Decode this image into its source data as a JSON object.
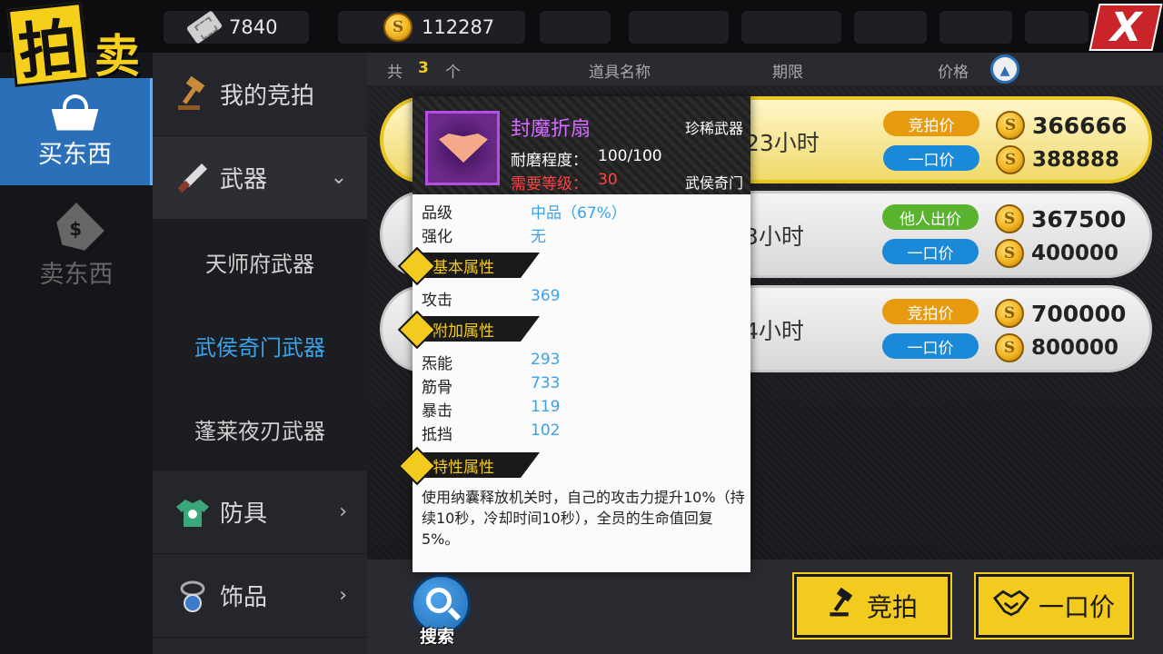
{
  "logo": {
    "char1": "拍",
    "char2": "卖"
  },
  "currency": {
    "tickets": "7840",
    "coins": "112287"
  },
  "close_label": "X",
  "left_tabs": [
    {
      "label": "买东西",
      "icon": "basket-icon",
      "active": true
    },
    {
      "label": "卖东西",
      "icon": "price-tag-icon",
      "active": false
    }
  ],
  "categories": {
    "my_bids": "我的竞拍",
    "weapons": "武器",
    "weapon_subs": [
      "天师府武器",
      "武侯奇门武器",
      "蓬莱夜刃武器"
    ],
    "armor": "防具",
    "accessories": "饰品"
  },
  "list_header": {
    "total_prefix": "共",
    "count": "3",
    "unit": "个",
    "col_name": "道具名称",
    "col_time": "期限",
    "col_price": "价格"
  },
  "rows": [
    {
      "time": "23小时",
      "label1": "竞拍价",
      "price1": "366666",
      "label2": "一口价",
      "price2": "388888",
      "label1_color": "orange"
    },
    {
      "time": "3小时",
      "label1": "他人出价",
      "price1": "367500",
      "label2": "一口价",
      "price2": "400000",
      "label1_color": "green"
    },
    {
      "time": "4小时",
      "label1": "竞拍价",
      "price1": "700000",
      "label2": "一口价",
      "price2": "800000",
      "label1_color": "orange"
    }
  ],
  "tooltip": {
    "name": "封魔折扇",
    "type": "珍稀武器",
    "durability_label": "耐磨程度：",
    "durability": "100/100",
    "level_label": "需要等级：",
    "level": "30",
    "school": "武侯奇门",
    "grade_label": "品级",
    "grade": "中品（67%）",
    "enhance_label": "强化",
    "enhance": "无",
    "basic_title": "基本属性",
    "attack_label": "攻击",
    "attack": "369",
    "extra_title": "附加属性",
    "extra": [
      {
        "label": "炁能",
        "value": "293"
      },
      {
        "label": "筋骨",
        "value": "733"
      },
      {
        "label": "暴击",
        "value": "119"
      },
      {
        "label": "抵挡",
        "value": "102"
      }
    ],
    "trait_title": "特性属性",
    "trait_desc": "使用纳囊释放机关时，自己的攻击力提升10%（持续10秒，冷却时间10秒），全员的生命值回复5%。"
  },
  "bottom": {
    "search": "搜索",
    "bid": "竞拍",
    "buyout": "一口价"
  },
  "colors": {
    "accent_blue": "#2a6fb8",
    "gold": "#f2cb1e",
    "rare_purple": "#d26bff"
  }
}
